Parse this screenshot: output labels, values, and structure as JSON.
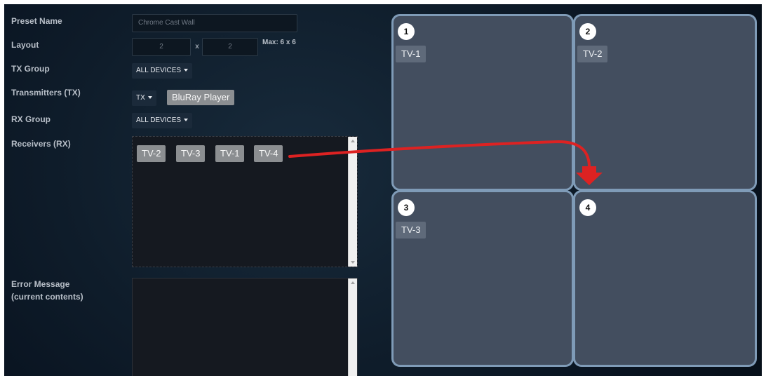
{
  "form": {
    "preset_name_label": "Preset Name",
    "preset_name_value": "Chrome Cast Wall",
    "layout_label": "Layout",
    "layout_cols": "2",
    "layout_x": "x",
    "layout_rows": "2",
    "layout_max": "Max: 6 x 6",
    "tx_group_label": "TX Group",
    "tx_group_value": "ALL DEVICES",
    "transmitters_label": "Transmitters (TX)",
    "tx_dropdown": "TX",
    "tx_selected": "BluRay Player",
    "rx_group_label": "RX Group",
    "rx_group_value": "ALL DEVICES",
    "receivers_label": "Receivers (RX)",
    "receivers": [
      "TV-2",
      "TV-3",
      "TV-1",
      "TV-4"
    ],
    "error_label_line1": "Error Message",
    "error_label_line2": "(current contents)",
    "error_value": ""
  },
  "grid": {
    "cells": [
      {
        "number": "1",
        "device": "TV-1"
      },
      {
        "number": "2",
        "device": "TV-2"
      },
      {
        "number": "3",
        "device": "TV-3"
      },
      {
        "number": "4",
        "device": ""
      }
    ]
  },
  "colors": {
    "arrow": "#dd2222",
    "cell_border": "#7f9bb7",
    "cell_bg": "#434e5f"
  }
}
